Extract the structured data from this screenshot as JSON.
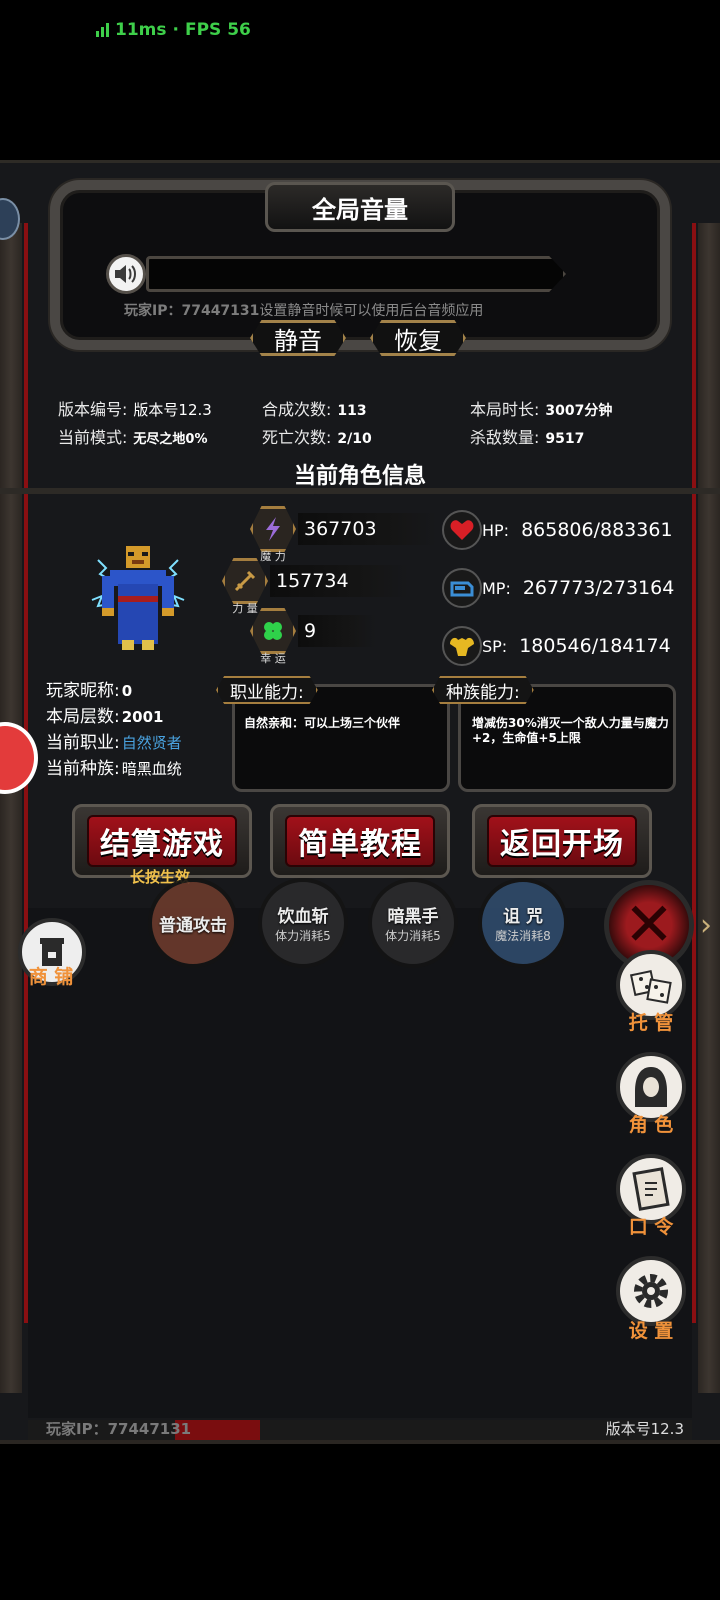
{
  "status": {
    "ping": "11ms",
    "sep": "·",
    "fps": "FPS 56"
  },
  "volume": {
    "title": "全局音量",
    "hint": "设置静音时候可以使用后台音频应用",
    "ip_overlay": "玩家IP：77447131",
    "mute_label": "静音",
    "restore_label": "恢复"
  },
  "stats": {
    "version_key": "版本编号:",
    "version_val": "版本号12.3",
    "mode_key": "当前模式:",
    "mode_val": "无尽之地0%",
    "craft_key": "合成次数:",
    "craft_val": "113",
    "death_key": "死亡次数:",
    "death_val": "2/10",
    "time_key": "本局时长:",
    "time_val": "3007分钟",
    "kill_key": "杀敌数量:",
    "kill_val": "9517"
  },
  "section_title": "当前角色信息",
  "attributes": {
    "magic": {
      "value": "367703",
      "caption": "魔 力",
      "icon": "lightning-icon"
    },
    "strength": {
      "value": "157734",
      "caption": "力 量",
      "icon": "sword-icon"
    },
    "luck": {
      "value": "9",
      "caption": "幸 运",
      "icon": "clover-icon"
    }
  },
  "vitals": {
    "hp": {
      "label": "HP:",
      "value": "865806/883361",
      "color": "#d81f26"
    },
    "mp": {
      "label": "MP:",
      "value": "267773/273164",
      "color": "#3b8ed6"
    },
    "sp": {
      "label": "SP:",
      "value": "180546/184174",
      "color": "#e6b822"
    }
  },
  "player": {
    "nick_key": "玩家昵称:",
    "nick_val": "0",
    "floor_key": "本局层数:",
    "floor_val": "2001",
    "job_key": "当前职业:",
    "job_val": "自然贤者",
    "race_key": "当前种族:",
    "race_val": "暗黑血统"
  },
  "abilities": {
    "job_tag": "职业能力:",
    "job_text": "自然亲和：可以上场三个伙伴",
    "race_tag": "种族能力:",
    "race_text_1": "增减伤30%消灭一个敌人力量与魔力",
    "race_text_2": "+2，生命值+5上限"
  },
  "buttons": {
    "settle": "结算游戏",
    "settle_hint": "长按生效",
    "tutorial": "简单教程",
    "back": "返回开场"
  },
  "skills": [
    {
      "name": "普通攻击",
      "cost": ""
    },
    {
      "name": "饮血斩",
      "cost": "体力消耗5"
    },
    {
      "name": "暗黑手",
      "cost": "体力消耗5"
    },
    {
      "name": "诅 咒",
      "cost": "魔法消耗8"
    }
  ],
  "side": {
    "shop": "商 铺",
    "auto": "托 管",
    "role": "角 色",
    "code": "口 令",
    "settings": "设 置"
  },
  "footer": {
    "ip": "玩家IP：77447131",
    "version": "版本号12.3"
  }
}
